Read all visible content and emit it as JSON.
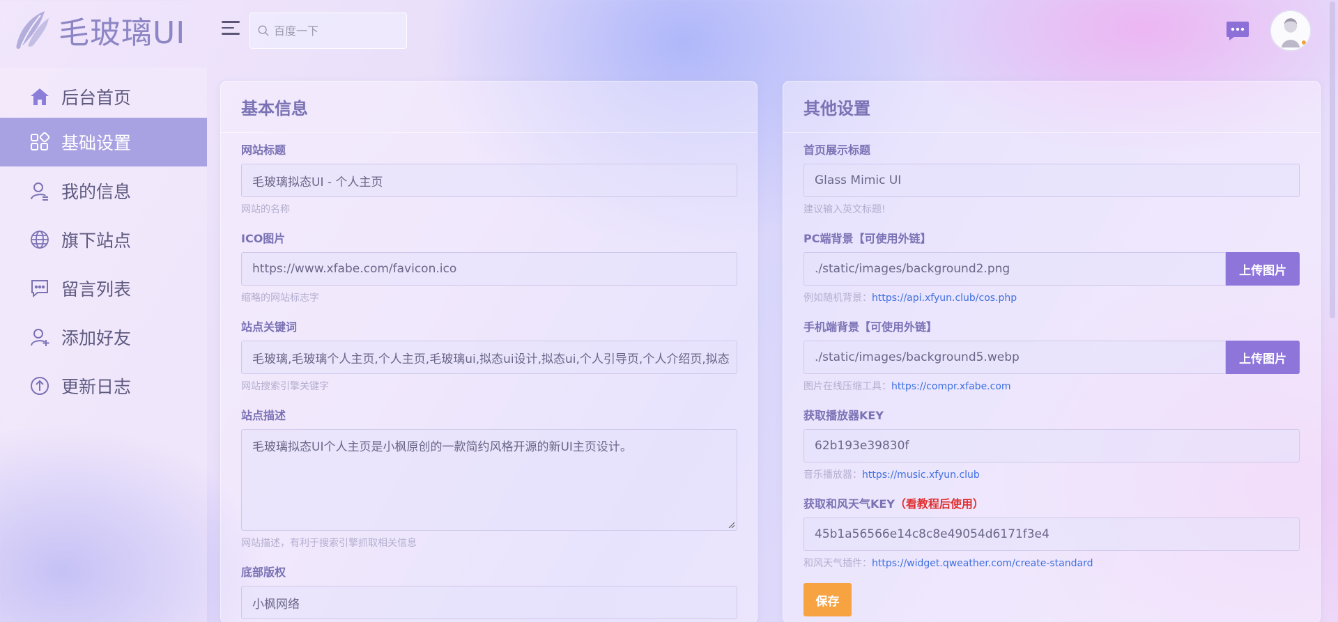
{
  "header": {
    "logo_text": "毛玻璃UI",
    "search_placeholder": "百度一下"
  },
  "sidebar": {
    "items": [
      {
        "label": "后台首页",
        "icon": "home-icon"
      },
      {
        "label": "基础设置",
        "icon": "grid-icon",
        "active": true
      },
      {
        "label": "我的信息",
        "icon": "user-icon"
      },
      {
        "label": "旗下站点",
        "icon": "globe-icon"
      },
      {
        "label": "留言列表",
        "icon": "chat-icon"
      },
      {
        "label": "添加好友",
        "icon": "user-add-icon"
      },
      {
        "label": "更新日志",
        "icon": "arrow-up-circle-icon"
      }
    ]
  },
  "basic": {
    "title": "基本信息",
    "site_title": {
      "label": "网站标题",
      "value": "毛玻璃拟态UI - 个人主页",
      "help": "网站的名称"
    },
    "ico": {
      "label": "ICO图片",
      "value": "https://www.xfabe.com/favicon.ico",
      "help": "缩略的网站标志字"
    },
    "keywords": {
      "label": "站点关键词",
      "value": "毛玻璃,毛玻璃个人主页,个人主页,毛玻璃ui,拟态ui设计,拟态ui,个人引导页,个人介绍页,拟态",
      "help": "网站搜索引擎关键字"
    },
    "description": {
      "label": "站点描述",
      "value": "毛玻璃拟态UI个人主页是小枫原创的一款简约风格开源的新UI主页设计。",
      "help": "网站描述，有利于搜索引擎抓取相关信息"
    },
    "copyright": {
      "label": "底部版权",
      "value": "小枫网络"
    }
  },
  "other": {
    "title": "其他设置",
    "home_title": {
      "label": "首页展示标题",
      "value": "Glass Mimic UI",
      "help": "建议输入英文标题!"
    },
    "pc_bg": {
      "label": "PC端背景【可使用外链】",
      "value": "./static/images/background2.png",
      "button": "上传图片",
      "help": "例如随机背景：",
      "link": "https://api.xfyun.club/cos.php"
    },
    "mobile_bg": {
      "label": "手机端背景【可使用外链】",
      "value": "./static/images/background5.webp",
      "button": "上传图片",
      "help": "图片在线压缩工具：",
      "link": "https://compr.xfabe.com"
    },
    "player_key": {
      "label": "获取播放器KEY",
      "value": "62b193e39830f",
      "help": "音乐播放器：",
      "link": "https://music.xfyun.club"
    },
    "weather_key": {
      "label": "获取和风天气KEY",
      "label_note": "（看教程后使用）",
      "value": "45b1a56566e14c8c8e49054d6171f3e4",
      "help": "和风天气插件：",
      "link": "https://widget.qweather.com/create-standard"
    },
    "save_label": "保存"
  },
  "colors": {
    "accent": "#8d75d9",
    "active_nav": "#a8a2e3",
    "save": "#f7a341",
    "warning_text": "#e02f2f",
    "link": "#3d6fe0"
  }
}
